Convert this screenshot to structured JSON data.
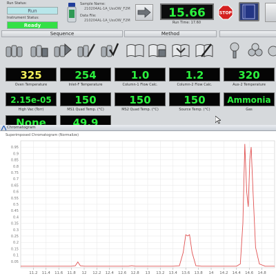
{
  "status": {
    "run_status_label": "Run Status:",
    "run_status_value": "Run",
    "instrument_status_label": "Instrument Status:",
    "instrument_status_value": "Ready"
  },
  "sample": {
    "name_label": "Sample Name:",
    "name_value": "210204AL-1A_UssOW_F2M",
    "datafile_label": "Data File:",
    "datafile_value": "210204AL-1A_UssOW_F2M"
  },
  "runtime": {
    "value": "15.66",
    "label": "Run Time: 17.60"
  },
  "sections": {
    "sequence": "Sequence",
    "method": "Method"
  },
  "readouts": [
    {
      "value": "325",
      "label": "Oven Temperature",
      "color": "yellow"
    },
    {
      "value": "254",
      "label": "Inlet-F Temperature",
      "color": "green"
    },
    {
      "value": "1.0",
      "label": "Column-1 Flow Calc.",
      "color": "green"
    },
    {
      "value": "1.2",
      "label": "Column-2 Flow Calc.",
      "color": "green"
    },
    {
      "value": "320",
      "label": "Aux-2 Temperature",
      "color": "green"
    },
    {
      "value": "2.15e-05",
      "label": "High Vac (Torr)",
      "color": "green"
    },
    {
      "value": "150",
      "label": "MS1 Quad Temp. (°C)",
      "color": "green"
    },
    {
      "value": "150",
      "label": "MS2 Quad Temp. (°C)",
      "color": "green"
    },
    {
      "value": "150",
      "label": "Source Temp. (°C)",
      "color": "green"
    },
    {
      "value": "Ammonia",
      "label": "Gas",
      "color": "green"
    },
    {
      "value": "None",
      "label": "",
      "color": "green"
    },
    {
      "value": "49.9",
      "label": "",
      "color": "green"
    }
  ],
  "chromatogram": {
    "window_title": "Chromatogram",
    "plot_title": "Superimposed Chromatogram (Normalize)"
  },
  "chart_data": {
    "type": "line",
    "title": "",
    "xlabel": "",
    "ylabel": "",
    "xlim": [
      11.0,
      15.0
    ],
    "ylim": [
      0,
      1.0
    ],
    "grid": true,
    "x_ticks": [
      "11.2",
      "11.4",
      "11.6",
      "11.8",
      "12",
      "12.2",
      "12.4",
      "12.6",
      "12.8",
      "13",
      "13.2",
      "13.4",
      "13.6",
      "13.8",
      "14",
      "14.2",
      "14.4",
      "14.6",
      "14.8"
    ],
    "y_ticks": [
      "0.05",
      "0.1",
      "0.15",
      "0.2",
      "0.25",
      "0.3",
      "0.35",
      "0.4",
      "0.45",
      "0.5",
      "0.55",
      "0.6",
      "0.65",
      "0.7",
      "0.75",
      "0.8",
      "0.85",
      "0.9",
      "0.95"
    ],
    "series": [
      {
        "color": "#e05050",
        "points": [
          [
            11.0,
            0.012
          ],
          [
            11.8,
            0.012
          ],
          [
            11.86,
            0.015
          ],
          [
            11.9,
            0.045
          ],
          [
            11.94,
            0.015
          ],
          [
            12.0,
            0.012
          ],
          [
            12.7,
            0.012
          ],
          [
            12.75,
            0.016
          ],
          [
            12.8,
            0.012
          ],
          [
            13.4,
            0.012
          ],
          [
            13.5,
            0.015
          ],
          [
            13.56,
            0.12
          ],
          [
            13.6,
            0.26
          ],
          [
            13.63,
            0.25
          ],
          [
            13.66,
            0.26
          ],
          [
            13.7,
            0.12
          ],
          [
            13.76,
            0.016
          ],
          [
            13.85,
            0.012
          ],
          [
            14.4,
            0.012
          ],
          [
            14.46,
            0.03
          ],
          [
            14.5,
            0.35
          ],
          [
            14.53,
            0.975
          ],
          [
            14.56,
            0.6
          ],
          [
            14.585,
            0.48
          ],
          [
            14.61,
            0.85
          ],
          [
            14.63,
            0.95
          ],
          [
            14.66,
            0.6
          ],
          [
            14.7,
            0.16
          ],
          [
            14.76,
            0.03
          ],
          [
            14.85,
            0.012
          ],
          [
            15.0,
            0.012
          ]
        ]
      }
    ]
  },
  "colors": {
    "readout_green": "#2bf23e",
    "readout_yellow": "#f3f05a",
    "ready_green": "#33e046",
    "trace_red": "#e05050"
  },
  "icons": [
    "sequence-load-icon",
    "sequence-save-icon",
    "sequence-run-icon",
    "sequence-edit-icon",
    "sequence-check-icon",
    "method-open-icon",
    "method-save-icon",
    "method-run-icon",
    "method-edit-icon",
    "tune-icon",
    "vials-icon",
    "settings-icon"
  ]
}
